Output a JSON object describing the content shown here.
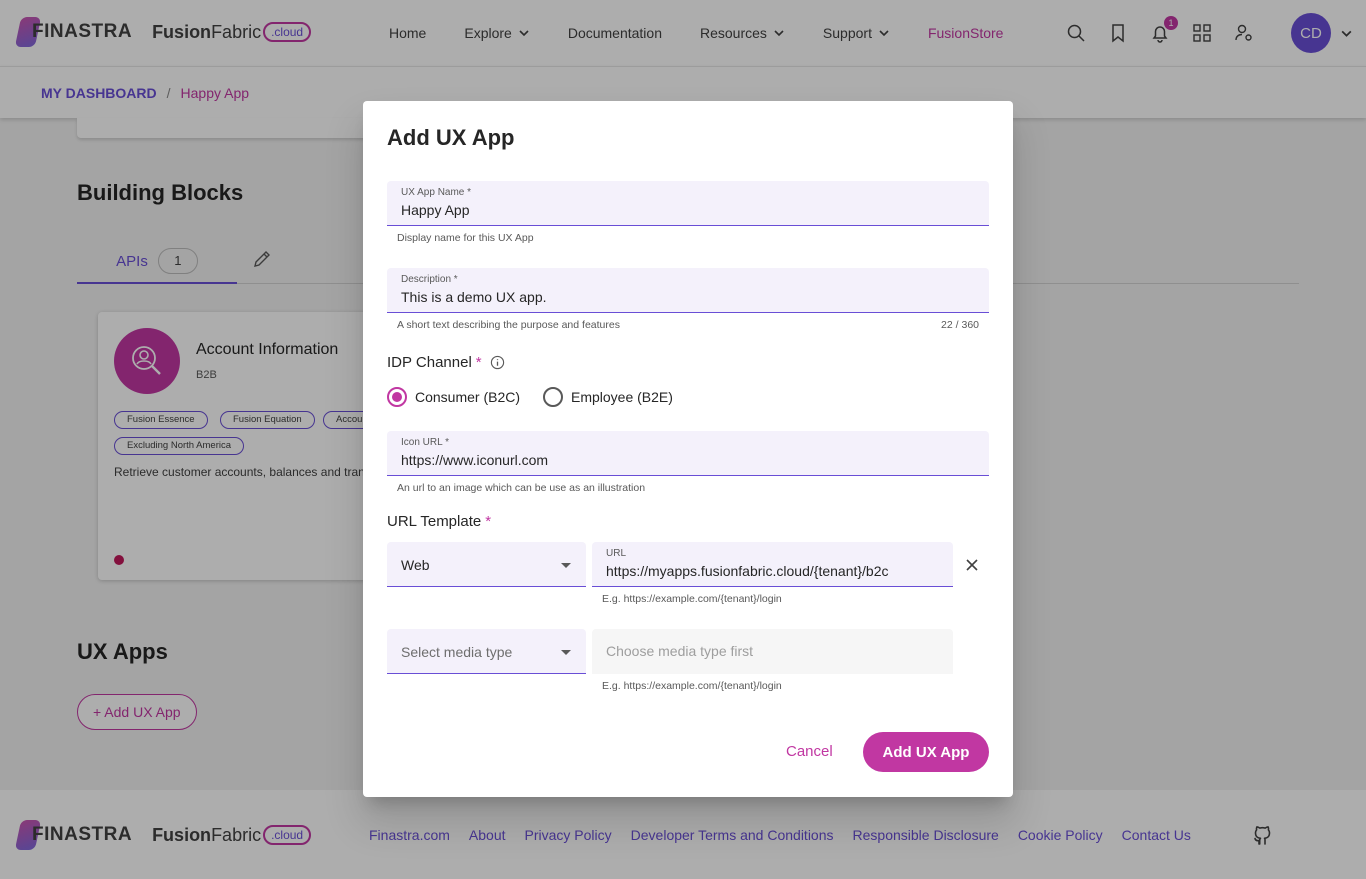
{
  "header": {
    "brand": "FINASTRA",
    "product_bold": "Fusion",
    "product_regular": "Fabric",
    "product_suffix": ".cloud",
    "nav": [
      {
        "label": "Home"
      },
      {
        "label": "Explore"
      },
      {
        "label": "Documentation"
      },
      {
        "label": "Resources"
      },
      {
        "label": "Support"
      },
      {
        "label": "FusionStore"
      }
    ],
    "notification_count": "1",
    "avatar_initials": "CD"
  },
  "breadcrumb": {
    "root": "MY DASHBOARD",
    "separator": "/",
    "current": "Happy App"
  },
  "building_blocks": {
    "title": "Building Blocks",
    "tab_label": "APIs",
    "tab_count": "1",
    "card": {
      "title": "Account Information",
      "subtitle": "B2B",
      "tags": [
        "Fusion Essence",
        "Fusion Equation",
        "Accou",
        "Excluding North America"
      ],
      "description": "Retrieve customer accounts, balances and tran history"
    }
  },
  "ux_apps": {
    "title": "UX Apps",
    "add_button": "+ Add UX App"
  },
  "footer": {
    "links": [
      "Finastra.com",
      "About",
      "Privacy Policy",
      "Developer Terms and Conditions",
      "Responsible Disclosure",
      "Cookie Policy",
      "Contact Us"
    ]
  },
  "dialog": {
    "title": "Add UX App",
    "name_field": {
      "label": "UX App Name *",
      "value": "Happy App",
      "hint": "Display name for this UX App"
    },
    "description_field": {
      "label": "Description *",
      "value": "This is a demo UX app.",
      "hint": "A short text describing the purpose and features",
      "counter": "22 / 360"
    },
    "idp_channel": {
      "label": "IDP Channel",
      "required_mark": "*",
      "options": [
        {
          "label": "Consumer (B2C)",
          "checked": true
        },
        {
          "label": "Employee (B2E)",
          "checked": false
        }
      ]
    },
    "icon_url_field": {
      "label": "Icon URL *",
      "value": "https://www.iconurl.com",
      "hint": "An url to an image which can be use as an illustration"
    },
    "url_template": {
      "label": "URL Template",
      "required_mark": "*",
      "rows": [
        {
          "media_type": "Web",
          "url_label": "URL",
          "url_value": "https://myapps.fusionfabric.cloud/{tenant}/b2c",
          "hint": "E.g. https://example.com/{tenant}/login"
        },
        {
          "media_type_placeholder": "Select media type",
          "url_placeholder": "Choose media type first",
          "hint": "E.g. https://example.com/{tenant}/login"
        }
      ]
    },
    "cancel_button": "Cancel",
    "submit_button": "Add UX App"
  },
  "colors": {
    "primary_magenta": "#c137a2",
    "primary_purple": "#694ed6",
    "field_fill": "#f4f1fb",
    "overlay": "rgba(0,0,0,0.32)"
  },
  "icons": [
    "finastra-logo-icon",
    "chevron-down-icon",
    "search-icon",
    "bookmark-icon",
    "bell-icon",
    "apps-grid-icon",
    "user-settings-icon",
    "pencil-icon",
    "user-search-icon",
    "info-icon",
    "close-icon",
    "github-icon"
  ]
}
